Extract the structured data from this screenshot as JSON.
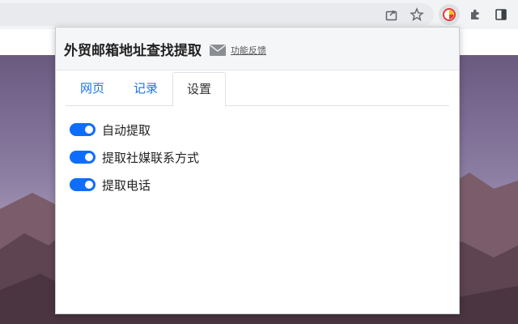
{
  "browser": {
    "toolbar_icons": [
      "share-icon",
      "star-icon",
      "extension-active-icon",
      "puzzle-icon",
      "side-panel-icon"
    ]
  },
  "popup": {
    "title": "外贸邮箱地址查找提取",
    "feedback_label": "功能反馈",
    "tabs": [
      {
        "label": "网页",
        "selected": false
      },
      {
        "label": "记录",
        "selected": false
      },
      {
        "label": "设置",
        "selected": true
      }
    ],
    "settings": [
      {
        "label": "自动提取",
        "enabled": true
      },
      {
        "label": "提取社媒联系方式",
        "enabled": true
      },
      {
        "label": "提取电话",
        "enabled": true
      }
    ]
  },
  "colors": {
    "accent": "#0d6efd",
    "tab_link": "#1a73e8"
  }
}
